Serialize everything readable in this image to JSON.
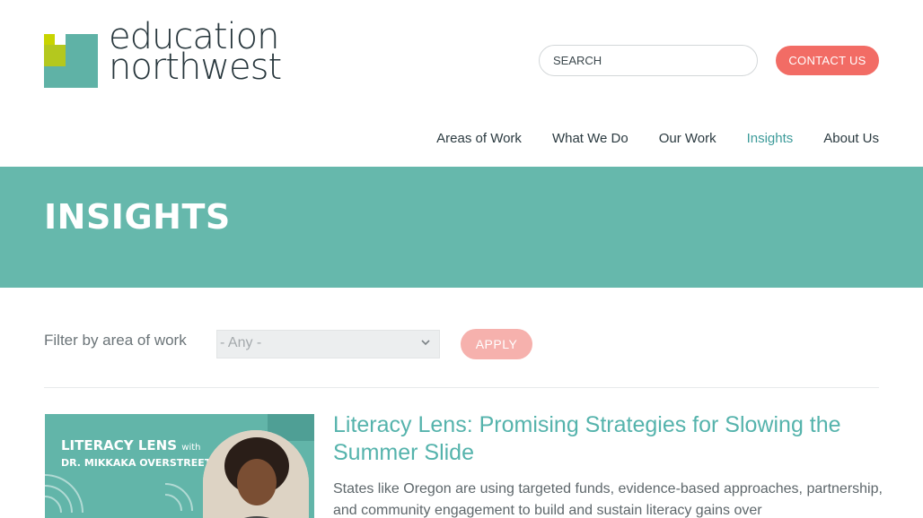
{
  "header": {
    "logo": {
      "line1": "education",
      "line2": "northwest"
    },
    "search": {
      "placeholder": "SEARCH"
    },
    "contact_label": "CONTACT US"
  },
  "nav": {
    "items": [
      {
        "label": "Areas of Work"
      },
      {
        "label": "What We Do"
      },
      {
        "label": "Our Work"
      },
      {
        "label": "Insights",
        "active": true
      },
      {
        "label": "About Us"
      }
    ]
  },
  "banner": {
    "title": "INSIGHTS"
  },
  "filter": {
    "label": "Filter by area of work",
    "selected": "- Any -",
    "apply_label": "APPLY"
  },
  "articles": [
    {
      "thumb_title": "LITERACY LENS",
      "thumb_with": "with",
      "thumb_subtitle": "DR. MIKKAKA OVERSTREET",
      "title": "Literacy Lens: Promising Strategies for Slowing the Summer Slide",
      "description": "States like Oregon are using targeted funds, evidence-based approaches, partnership, and community engagement to build and sustain literacy gains over"
    }
  ],
  "colors": {
    "teal_banner": "#66b8ac",
    "accent_coral": "#f26c65",
    "nav_active": "#3d9b9a",
    "article_title": "#55b3ac"
  }
}
